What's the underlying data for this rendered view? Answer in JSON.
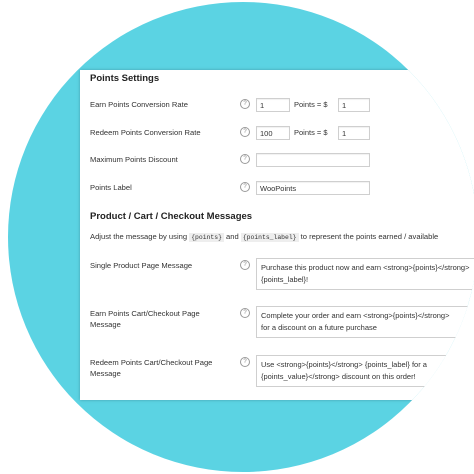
{
  "points_settings": {
    "title": "Points Settings",
    "earn": {
      "label": "Earn Points Conversion Rate",
      "points": "1",
      "sep": "Points = $",
      "dollars": "1"
    },
    "redeem": {
      "label": "Redeem Points Conversion Rate",
      "points": "100",
      "sep": "Points = $",
      "dollars": "1"
    },
    "max_discount": {
      "label": "Maximum Points Discount",
      "value": ""
    },
    "points_label": {
      "label": "Points Label",
      "value": "WooPoints"
    },
    "help_glyph": "?"
  },
  "messages": {
    "title": "Product / Cart / Checkout Messages",
    "desc_prefix": "Adjust the message by using",
    "code_points": "{points}",
    "desc_and": "and",
    "code_points_label": "{points_label}",
    "desc_suffix": "to represent the points earned / available",
    "single": {
      "label": "Single Product Page Message",
      "value": "Purchase this product now and earn <strong>{points}</strong>\n{points_label}!"
    },
    "earn_cart": {
      "label_1": "Earn Points Cart/Checkout Page",
      "label_2": "Message",
      "value": "Complete your order and earn <strong>{points}</strong>\nfor a discount on a future purchase"
    },
    "redeem_cart": {
      "label_1": "Redeem Points Cart/Checkout Page",
      "label_2": "Message",
      "value": "Use <strong>{points}</strong> {points_label} for a\n{points_value}</strong> discount on this order!"
    }
  }
}
